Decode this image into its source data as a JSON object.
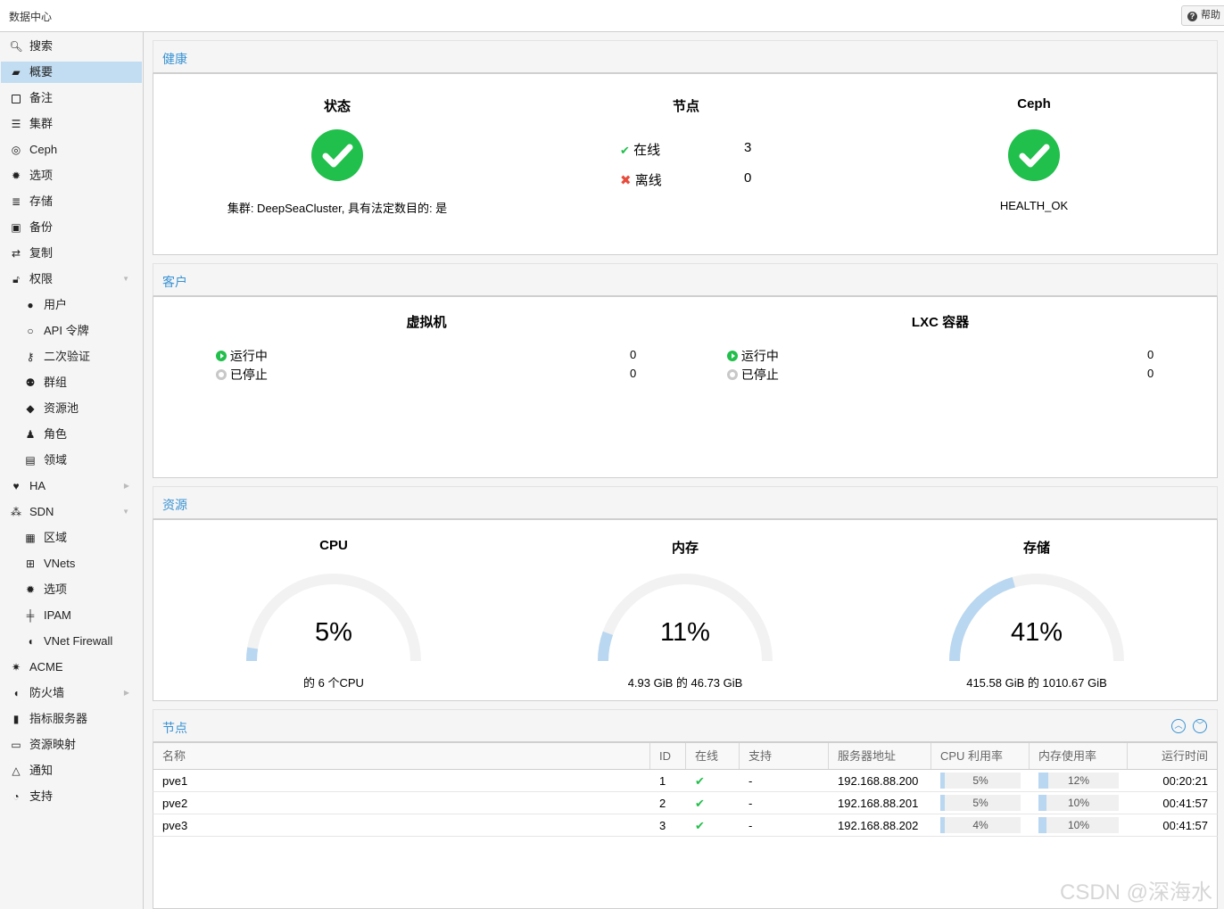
{
  "topbar": {
    "title": "数据中心",
    "help_label": "帮助"
  },
  "sidebar": {
    "items": [
      {
        "label": "搜索",
        "icon": "search-icon"
      },
      {
        "label": "概要",
        "icon": "book-icon"
      },
      {
        "label": "备注",
        "icon": "note-icon"
      },
      {
        "label": "集群",
        "icon": "server-icon"
      },
      {
        "label": "Ceph",
        "icon": "ceph-icon"
      },
      {
        "label": "选项",
        "icon": "gear-icon"
      },
      {
        "label": "存储",
        "icon": "database-icon"
      },
      {
        "label": "备份",
        "icon": "floppy-icon"
      },
      {
        "label": "复制",
        "icon": "retweet-icon"
      },
      {
        "label": "权限",
        "icon": "unlock-icon"
      },
      {
        "label": "用户",
        "icon": "user-icon"
      },
      {
        "label": "API 令牌",
        "icon": "user-outline-icon"
      },
      {
        "label": "二次验证",
        "icon": "key-icon"
      },
      {
        "label": "群组",
        "icon": "users-icon"
      },
      {
        "label": "资源池",
        "icon": "tags-icon"
      },
      {
        "label": "角色",
        "icon": "male-icon"
      },
      {
        "label": "领域",
        "icon": "address-book-icon"
      },
      {
        "label": "HA",
        "icon": "heartbeat-icon"
      },
      {
        "label": "SDN",
        "icon": "sdn-icon"
      },
      {
        "label": "区域",
        "icon": "th-icon"
      },
      {
        "label": "VNets",
        "icon": "network-icon"
      },
      {
        "label": "选项",
        "icon": "gear-icon"
      },
      {
        "label": "IPAM",
        "icon": "ipam-icon"
      },
      {
        "label": "VNet Firewall",
        "icon": "shield-icon"
      },
      {
        "label": "ACME",
        "icon": "certificate-icon"
      },
      {
        "label": "防火墙",
        "icon": "shield-icon"
      },
      {
        "label": "指标服务器",
        "icon": "bar-chart-icon"
      },
      {
        "label": "资源映射",
        "icon": "folder-icon"
      },
      {
        "label": "通知",
        "icon": "bell-icon"
      },
      {
        "label": "支持",
        "icon": "comments-icon"
      }
    ]
  },
  "health": {
    "title": "健康",
    "status_title": "状态",
    "status_text": "集群: DeepSeaCluster, 具有法定数目的: 是",
    "nodes_title": "节点",
    "online_label": "在线",
    "online_value": "3",
    "offline_label": "离线",
    "offline_value": "0",
    "ceph_title": "Ceph",
    "ceph_status": "HEALTH_OK"
  },
  "guests": {
    "title": "客户",
    "vm_title": "虚拟机",
    "lxc_title": "LXC 容器",
    "running_label": "运行中",
    "stopped_label": "已停止",
    "vm_running": "0",
    "vm_stopped": "0",
    "lxc_running": "0",
    "lxc_stopped": "0"
  },
  "resources": {
    "title": "资源",
    "cpu": {
      "title": "CPU",
      "percent": "5%",
      "fraction": 0.05,
      "detail": "的 6 个CPU"
    },
    "memory": {
      "title": "内存",
      "percent": "11%",
      "fraction": 0.11,
      "detail": "4.93 GiB 的 46.73 GiB"
    },
    "storage": {
      "title": "存储",
      "percent": "41%",
      "fraction": 0.41,
      "detail": "415.58 GiB 的 1010.67 GiB"
    }
  },
  "nodes": {
    "title": "节点",
    "columns": [
      "名称",
      "ID",
      "在线",
      "支持",
      "服务器地址",
      "CPU 利用率",
      "内存使用率",
      "运行时间"
    ],
    "rows": [
      {
        "name": "pve1",
        "id": "1",
        "support": "-",
        "address": "192.168.88.200",
        "cpu": "5%",
        "cpu_frac": 0.05,
        "mem": "12%",
        "mem_frac": 0.12,
        "uptime": "00:20:21"
      },
      {
        "name": "pve2",
        "id": "2",
        "support": "-",
        "address": "192.168.88.201",
        "cpu": "5%",
        "cpu_frac": 0.05,
        "mem": "10%",
        "mem_frac": 0.1,
        "uptime": "00:41:57"
      },
      {
        "name": "pve3",
        "id": "3",
        "support": "-",
        "address": "192.168.88.202",
        "cpu": "4%",
        "cpu_frac": 0.04,
        "mem": "10%",
        "mem_frac": 0.1,
        "uptime": "00:41:57"
      }
    ]
  },
  "watermark": "CSDN @深海水",
  "colors": {
    "accent": "#3892d4",
    "ok": "#21bf4b",
    "error": "#e74c3c",
    "selected": "#c2ddf2",
    "gauge_fill": "#b9d7f0",
    "gauge_track": "#f2f2f2"
  }
}
